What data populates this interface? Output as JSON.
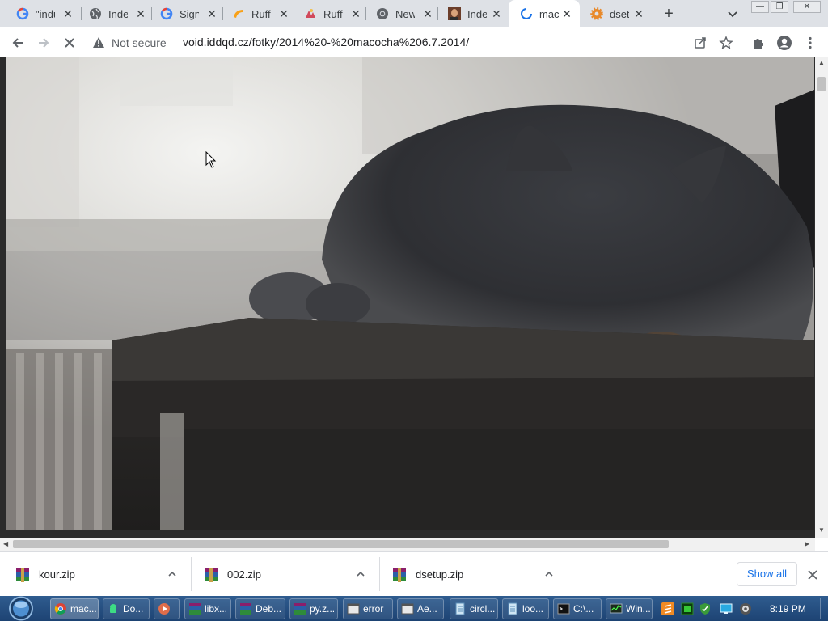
{
  "tabs": [
    {
      "title": "\"indu",
      "icon": "google-icon"
    },
    {
      "title": "Inde",
      "icon": "globe-icon"
    },
    {
      "title": "Sign",
      "icon": "google-icon"
    },
    {
      "title": "Ruffl",
      "icon": "ruffle-icon"
    },
    {
      "title": "Ruffl",
      "icon": "ruffle-alt-icon"
    },
    {
      "title": "New",
      "icon": "chrome-icon"
    },
    {
      "title": "Inde",
      "icon": "portrait-icon"
    },
    {
      "title": "mac",
      "icon": "loading-spinner-icon"
    },
    {
      "title": "dset",
      "icon": "gear-orange-icon"
    }
  ],
  "toolbar": {
    "security_text": "Not secure",
    "url": "void.iddqd.cz/fotky/2014%20-%20macocha%206.7.2014/"
  },
  "downloads": [
    {
      "name": "kour.zip"
    },
    {
      "name": "002.zip"
    },
    {
      "name": "dsetup.zip"
    }
  ],
  "shelf": {
    "show_all": "Show all"
  },
  "taskbar": {
    "items": [
      {
        "label": "mac...",
        "icon": "chrome-icon"
      },
      {
        "label": "Do...",
        "icon": "android-icon"
      },
      {
        "label": "",
        "icon": "media-player-icon"
      },
      {
        "label": "libx...",
        "icon": "winrar-icon"
      },
      {
        "label": "Deb...",
        "icon": "winrar-icon"
      },
      {
        "label": "py.z...",
        "icon": "winrar-icon"
      },
      {
        "label": "error",
        "icon": "app-window-icon"
      },
      {
        "label": "Ae...",
        "icon": "app-window-icon"
      },
      {
        "label": "circl...",
        "icon": "notepad-icon"
      },
      {
        "label": "loo...",
        "icon": "notepad-icon"
      },
      {
        "label": "C:\\...",
        "icon": "cmd-icon"
      },
      {
        "label": "Win...",
        "icon": "task-manager-icon"
      }
    ],
    "clock": "8:19 PM"
  },
  "colors": {
    "tabstrip": "#dee1e6",
    "link_blue": "#1a73e8",
    "taskbar": "#2f5c8f"
  }
}
